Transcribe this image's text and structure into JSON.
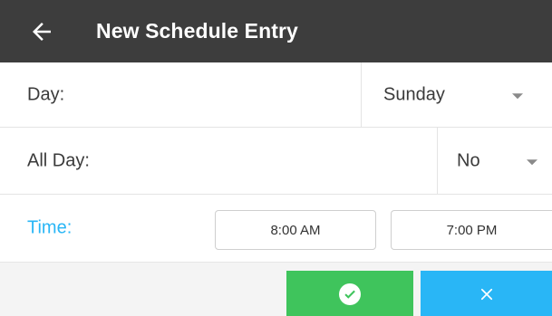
{
  "header": {
    "title": "New Schedule Entry",
    "back_icon": "arrow-left-icon",
    "background": "#3d3d3d"
  },
  "form": {
    "day": {
      "label": "Day:",
      "value": "Sunday"
    },
    "all_day": {
      "label": "All Day:",
      "value": "No"
    },
    "time": {
      "label": "Time:",
      "start": "8:00 AM",
      "end": "7:00 PM",
      "label_color": "#29b6f6"
    }
  },
  "actions": {
    "confirm": {
      "icon": "check-circle-icon",
      "color": "#3fc45c"
    },
    "cancel": {
      "icon": "close-icon",
      "color": "#29b6f6"
    }
  }
}
